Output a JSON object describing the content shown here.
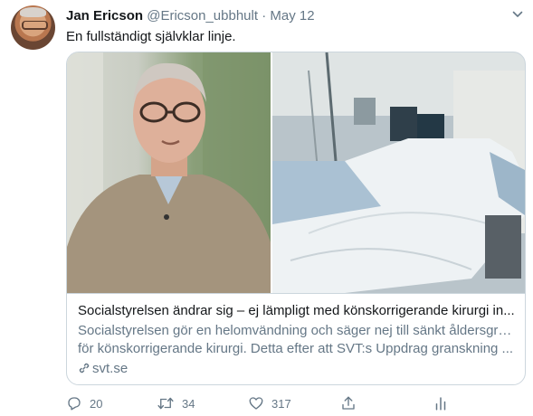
{
  "tweet": {
    "author_name": "Jan Ericson",
    "handle": "@Ericson_ubbhult",
    "separator": "·",
    "date": "May 12",
    "text": "En fullständigt självklar linje."
  },
  "card": {
    "title": "Socialstyrelsen ändrar sig – ej lämpligt med könskorrigerande kirurgi in...",
    "description_line1": "Socialstyrelsen gör en helomvändning och säger nej till sänkt åldersgräns",
    "description_line2": "för könskorrigerande kirurgi. Detta efter att SVT:s Uppdrag granskning ...",
    "domain": "svt.se"
  },
  "actions": {
    "replies": "20",
    "retweets": "34",
    "likes": "317"
  },
  "icons": {
    "reply": "reply-icon",
    "retweet": "retweet-icon",
    "like": "heart-icon",
    "share": "share-icon",
    "analytics": "analytics-icon",
    "link": "link-icon",
    "caret": "chevron-down-icon"
  },
  "colors": {
    "secondary_text": "#657786",
    "border": "#ccd6dd",
    "primary_text": "#14171a"
  }
}
